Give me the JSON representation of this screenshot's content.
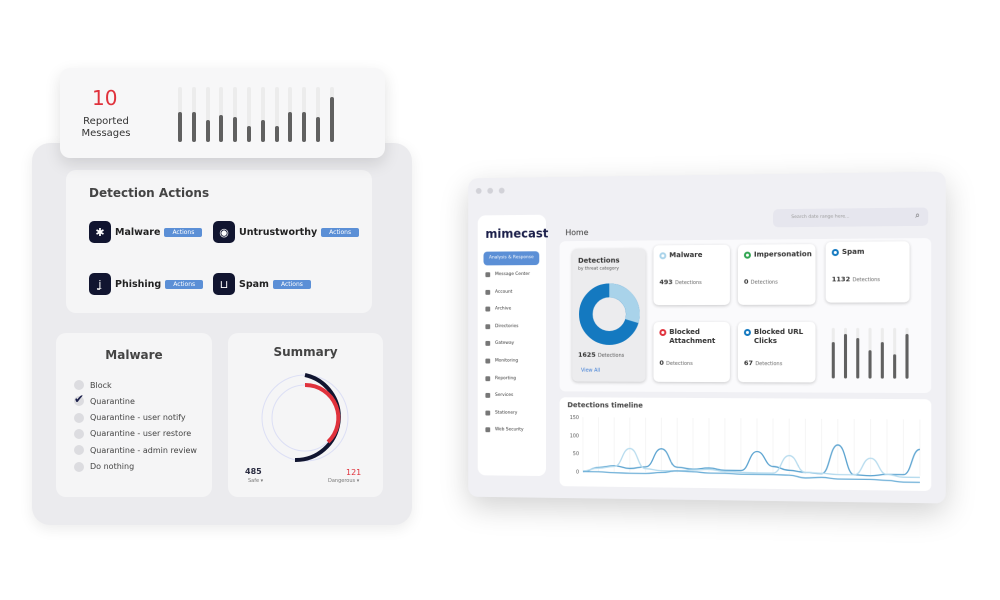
{
  "reported": {
    "count": "10",
    "label": "Reported Messages",
    "bars": [
      0.55,
      0.55,
      0.4,
      0.5,
      0.45,
      0.3,
      0.4,
      0.3,
      0.55,
      0.55,
      0.45,
      0.82
    ]
  },
  "detection_actions": {
    "title": "Detection Actions",
    "items": [
      {
        "label": "Malware",
        "action": "Actions",
        "icon": "bug-icon"
      },
      {
        "label": "Untrustworthy",
        "action": "Actions",
        "icon": "shield-icon"
      },
      {
        "label": "Phishing",
        "action": "Actions",
        "icon": "hook-icon"
      },
      {
        "label": "Spam",
        "action": "Actions",
        "icon": "inbox-icon"
      }
    ]
  },
  "malware": {
    "title": "Malware",
    "options": [
      "Block",
      "Quarantine",
      "Quarantine - user notify",
      "Quarantine - user restore",
      "Quarantine - admin review",
      "Do nothing"
    ],
    "selected": "Quarantine"
  },
  "summary": {
    "title": "Summary",
    "safe": {
      "value": "485",
      "label": "Safe"
    },
    "dangerous": {
      "value": "121",
      "label": "Dangerous"
    },
    "colors": {
      "safe": "#111530",
      "dangerous": "#e0323c"
    }
  },
  "dashboard": {
    "logo": "mimecast",
    "page_title": "Home",
    "search_placeholder": "Search date range here...",
    "nav": [
      "Analysis & Response",
      "Message Center",
      "Account",
      "Archive",
      "Directories",
      "Gateway",
      "Monitoring",
      "Reporting",
      "Services",
      "Stationery",
      "Web Security"
    ],
    "detections": {
      "title": "Detections",
      "subtitle": "by threat category",
      "total": "1625",
      "unit": "Detections",
      "link": "View All"
    },
    "tiles": [
      {
        "label": "Malware",
        "count": "493",
        "unit": "Detections",
        "color": "#a9d3ea"
      },
      {
        "label": "Impersonation",
        "count": "0",
        "unit": "Detections",
        "color": "#2ea44f"
      },
      {
        "label": "Spam",
        "count": "1132",
        "unit": "Detections",
        "color": "#1479c0"
      },
      {
        "label": "Blocked Attachment",
        "count": "0",
        "unit": "Detections",
        "color": "#e0323c"
      },
      {
        "label": "Blocked URL Clicks",
        "count": "67",
        "unit": "Detections",
        "color": "#1479c0"
      }
    ],
    "mini_bars": [
      0.45,
      0.55,
      0.5,
      0.35,
      0.45,
      0.3,
      0.55
    ]
  },
  "chart_data": {
    "type": "line",
    "title": "Detections timeline",
    "yticks": [
      "150",
      "100",
      "50",
      "0"
    ],
    "ylim": [
      0,
      150
    ],
    "series": [
      {
        "values": [
          0,
          12,
          17,
          10,
          15,
          65,
          15,
          10,
          14,
          8,
          8,
          60,
          20,
          10,
          5,
          2,
          80,
          0,
          -2,
          2,
          2,
          70
        ],
        "color": "#5ba3d0"
      },
      {
        "values": [
          2,
          10,
          15,
          65,
          10,
          5,
          5,
          8,
          10,
          5,
          3,
          2,
          2,
          50,
          5,
          3,
          0,
          0,
          45,
          2,
          -5,
          -5
        ],
        "color": "#b6dbee"
      },
      {
        "values": [
          0,
          0,
          -2,
          -3,
          -3,
          0,
          5,
          3,
          0,
          0,
          -2,
          -2,
          -2,
          -3,
          -10,
          -8,
          -12,
          -12,
          -12,
          -14,
          -18,
          -18
        ],
        "color": "#6fb0d8"
      }
    ]
  }
}
